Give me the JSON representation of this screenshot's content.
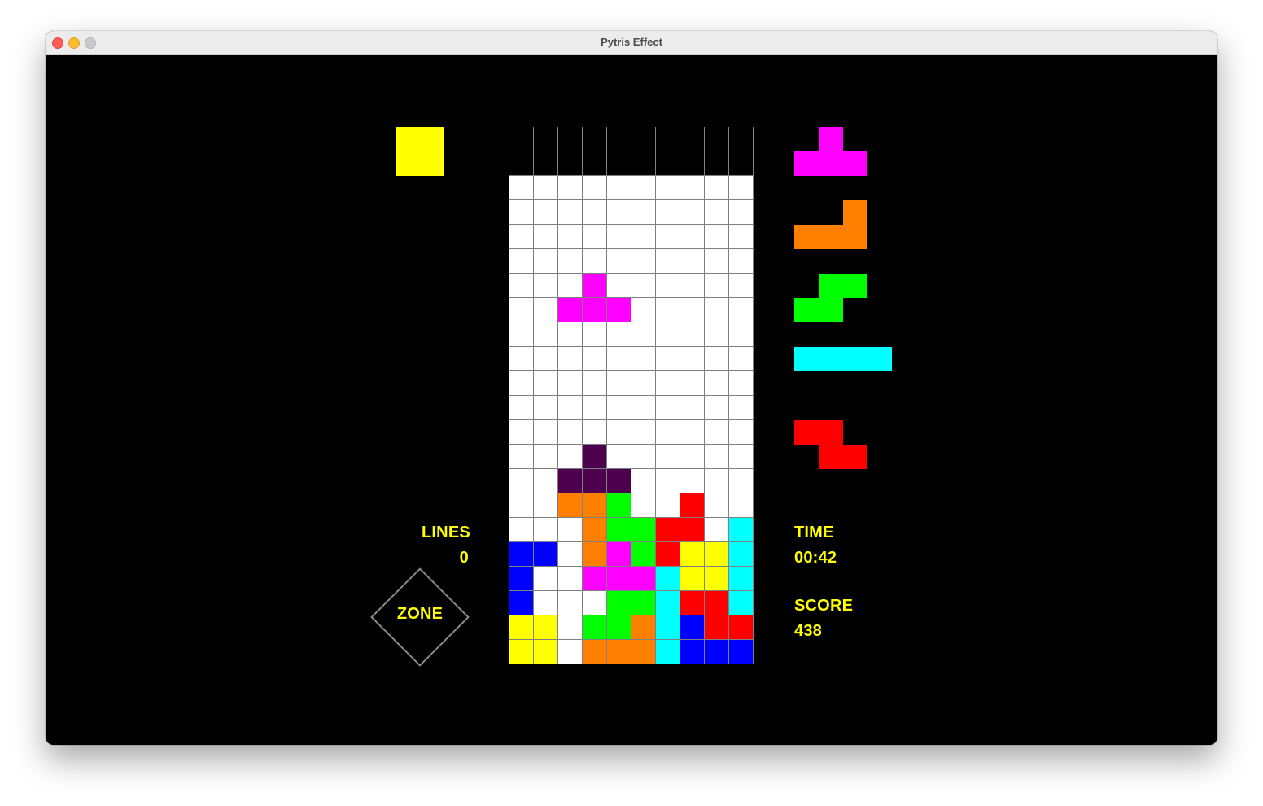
{
  "window": {
    "title": "Pytris Effect"
  },
  "colors": {
    "I": "#00ffff",
    "O": "#ffff00",
    "T": "#ff00ff",
    "S": "#00ff00",
    "Z": "#ff0000",
    "J": "#0000ff",
    "L": "#ff8000",
    "ghost": "#4d004d",
    "empty": "#ffffff",
    "hidden": "#000000",
    "grid": "#808080",
    "hud_text": "#ffff00"
  },
  "board": {
    "cols": 10,
    "rows": [
      "..........",
      "..........",
      "..........",
      "..........",
      "..........",
      "..........",
      "...T......",
      "..TTT.....",
      "..........",
      "..........",
      "..........",
      "..........",
      "..........",
      "...g......",
      "..ggg.....",
      "..LLS..Z..",
      "...LSSZZ.I",
      "JJ.LTSZOOI",
      "J..TTTIOOI",
      "J...SSIZZI",
      "OO.SSLIJZZ",
      "OO.LLLIJJJ"
    ],
    "hidden_rows": 2
  },
  "hold": {
    "piece": "O",
    "cells": [
      [
        0,
        0
      ],
      [
        0,
        1
      ],
      [
        1,
        0
      ],
      [
        1,
        1
      ]
    ]
  },
  "next_queue": [
    {
      "piece": "T",
      "cells": [
        [
          0,
          1
        ],
        [
          1,
          0
        ],
        [
          1,
          1
        ],
        [
          1,
          2
        ]
      ]
    },
    {
      "piece": "L",
      "cells": [
        [
          0,
          2
        ],
        [
          1,
          0
        ],
        [
          1,
          1
        ],
        [
          1,
          2
        ]
      ]
    },
    {
      "piece": "S",
      "cells": [
        [
          0,
          1
        ],
        [
          0,
          2
        ],
        [
          1,
          0
        ],
        [
          1,
          1
        ]
      ]
    },
    {
      "piece": "I",
      "cells": [
        [
          0,
          0
        ],
        [
          0,
          1
        ],
        [
          0,
          2
        ],
        [
          0,
          3
        ]
      ]
    },
    {
      "piece": "Z",
      "cells": [
        [
          0,
          0
        ],
        [
          0,
          1
        ],
        [
          1,
          1
        ],
        [
          1,
          2
        ]
      ]
    }
  ],
  "hud": {
    "lines_label": "LINES",
    "lines_value": "0",
    "time_label": "TIME",
    "time_value": "00:42",
    "score_label": "SCORE",
    "score_value": "438",
    "zone_label": "ZONE"
  }
}
